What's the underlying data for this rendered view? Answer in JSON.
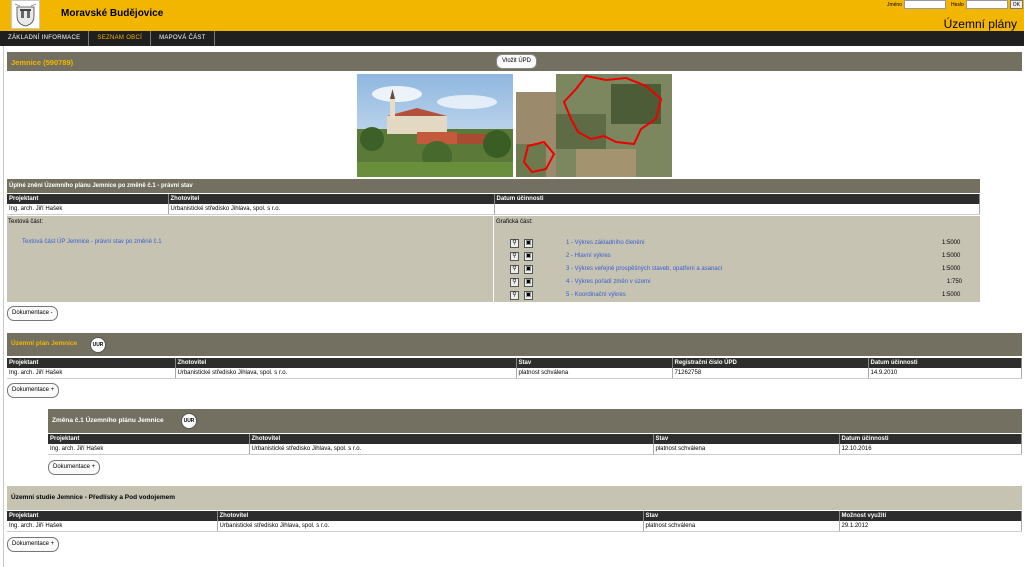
{
  "header": {
    "city": "Moravské Budějovice",
    "section": "Územní plány",
    "login": {
      "name_label": "Jméno",
      "pass_label": "Heslo",
      "ok": "OK"
    }
  },
  "nav": [
    "ZÁKLADNÍ INFORMACE",
    "SEZNAM OBCÍ",
    "MAPOVÁ ČÁST"
  ],
  "main": {
    "title": "Jemnice (590789)",
    "insert_btn": "Vložit ÚPD"
  },
  "full_text": {
    "title": "Úplné znění Územního plánu Jemnice po změně č.1 - právní stav",
    "headers": [
      "Projektant",
      "Zhotovitel",
      "Datum účinnosti"
    ],
    "row": [
      "Ing. arch. Jiří Hašek",
      "Urbanistické středisko Jihlava, spol. s r.o.",
      ""
    ],
    "text_label": "Textová část:",
    "text_link": "Textová část ÚP Jemnice - právní stav po změně č.1",
    "graphic_label": "Grafická část:",
    "drawings": [
      {
        "name": "1 - Výkres základního členění",
        "scale": "1:5000"
      },
      {
        "name": "2 - Hlavní výkres",
        "scale": "1:5000"
      },
      {
        "name": "3 - Výkres veřejně prospěšných staveb, opatření a asanací",
        "scale": "1:5000"
      },
      {
        "name": "4 - Výkres pořadí změn v území",
        "scale": "1:750"
      },
      {
        "name": "5 - Koordinační výkres",
        "scale": "1:5000"
      }
    ],
    "doc_btn": "Dokumentace -"
  },
  "plan": {
    "title": "Územní plán Jemnice",
    "badge": "UUR",
    "headers": [
      "Projektant",
      "Zhotovitel",
      "Stav",
      "Registrační číslo ÚPD",
      "Datum účinnosti"
    ],
    "row": [
      "Ing. arch. Jiří Hašek",
      "Urbanistické středisko Jihlava, spol. s r.o.",
      "platnost schválena",
      "71262758",
      "14.9.2010"
    ],
    "doc_btn": "Dokumentace +"
  },
  "change": {
    "title": "Změna č.1 Územního plánu Jemnice",
    "badge": "UUR",
    "headers": [
      "Projektant",
      "Zhotovitel",
      "Stav",
      "Datum účinnosti"
    ],
    "row": [
      "Ing. arch. Jiří Hašek",
      "Urbanistické středisko Jihlava, spol. s r.o.",
      "platnost schválena",
      "12.10.2016"
    ],
    "doc_btn": "Dokumentace +"
  },
  "study": {
    "title": "Územní studie Jemnice - Předlísky a Pod vodojemem",
    "headers": [
      "Projektant",
      "Zhotovitel",
      "Stav",
      "Možnost využití"
    ],
    "row": [
      "Ing. arch. Jiří Hašek",
      "Urbanistické středisko Jihlava, spol. s r.o.",
      "platnost schválena",
      "29.1.2012"
    ],
    "doc_btn": "Dokumentace +"
  },
  "colors": {
    "accent": "#f3b600",
    "bar": "#737061",
    "nav": "#1f1f1f",
    "link": "#3a5fcd",
    "panel": "#c6c3b3"
  }
}
